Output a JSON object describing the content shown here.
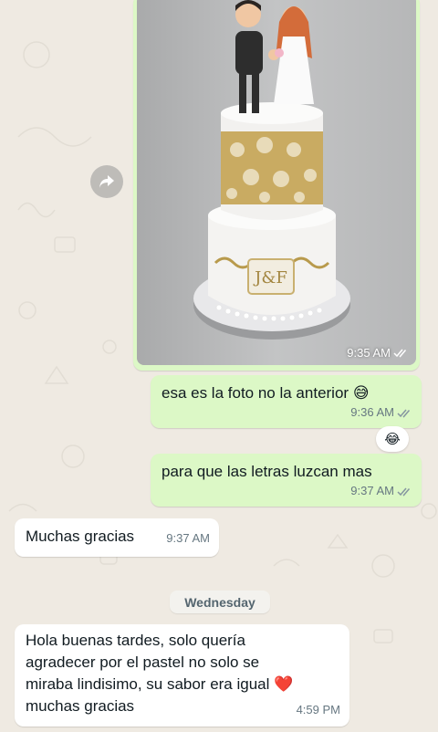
{
  "messages": [
    {
      "type": "image",
      "direction": "outgoing",
      "time": "9:35 AM",
      "status": "read",
      "image_subject": "wedding-cake-photo"
    },
    {
      "type": "text",
      "direction": "outgoing",
      "text": "esa es la foto no la anterior",
      "emoji": "😅",
      "time": "9:36 AM",
      "status": "read",
      "reaction": "😂"
    },
    {
      "type": "text",
      "direction": "outgoing",
      "text": "para que las letras luzcan mas",
      "time": "9:37 AM",
      "status": "read"
    },
    {
      "type": "text",
      "direction": "incoming",
      "text": "Muchas gracias",
      "time": "9:37 AM"
    },
    {
      "type": "text",
      "direction": "incoming",
      "lines": [
        "Hola buenas tardes, solo quería",
        "agradecer por el pastel no solo se",
        "miraba lindisimo, su sabor era igual",
        "muchas gracias"
      ],
      "emoji": "❤️",
      "time": "4:59 PM"
    }
  ],
  "date_separator": "Wednesday",
  "colors": {
    "wallpaper": "#efeae2",
    "outgoing_bubble": "#dcf8c6",
    "incoming_bubble": "#ffffff",
    "read_ticks": "#8696a0",
    "meta_text": "#667781"
  },
  "icons": {
    "forward": "forward-arrow-icon",
    "read_status": "double-check-icon"
  }
}
